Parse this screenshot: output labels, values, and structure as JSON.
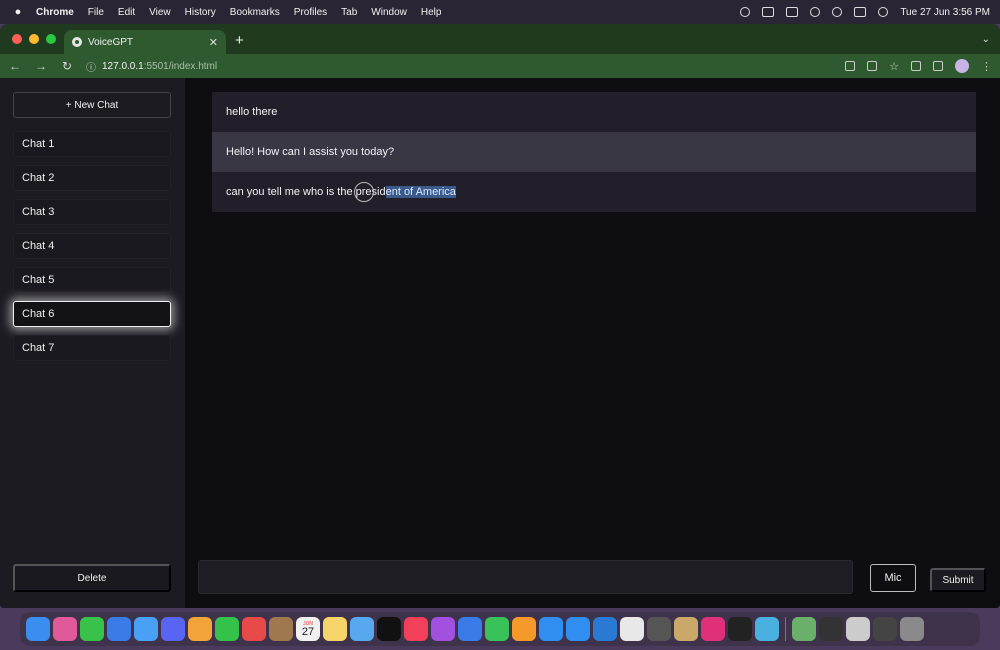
{
  "menubar": {
    "app": "Chrome",
    "items": [
      "File",
      "Edit",
      "View",
      "History",
      "Bookmarks",
      "Profiles",
      "Tab",
      "Window",
      "Help"
    ],
    "datetime": "Tue 27 Jun  3:56 PM"
  },
  "browser": {
    "tab_title": "VoiceGPT",
    "url_host": "127.0.0.1",
    "url_path": ":5501/index.html"
  },
  "sidebar": {
    "new_chat_label": "+ New Chat",
    "chats": [
      "Chat 1",
      "Chat 2",
      "Chat 3",
      "Chat 4",
      "Chat 5",
      "Chat 6",
      "Chat 7"
    ],
    "active_chat": "Chat 6",
    "delete_label": "Delete"
  },
  "conversation": {
    "messages": [
      {
        "role": "user",
        "text": "hello there"
      },
      {
        "role": "assistant",
        "text": "Hello! How can I assist you today?"
      },
      {
        "role": "user",
        "text_plain": "can you tell me who is the presid",
        "text_selected": "ent of America"
      }
    ]
  },
  "composer": {
    "input_value": "",
    "mic_label": "Mic",
    "submit_label": "Submit"
  },
  "dock": {
    "calendar_day": "27",
    "calendar_month": "JUN",
    "icon_colors": [
      "#3b8ef0",
      "#e05a9a",
      "#38c24a",
      "#3a7be8",
      "#4aa0f5",
      "#5865f2",
      "#f2a33a",
      "#35c24a",
      "#e84a4a",
      "#a07850",
      "#f0f0f0",
      "#f5d56a",
      "#58a8f0",
      "#111111",
      "#f2405a",
      "#a250e0",
      "#3a7be8",
      "#3ac25a",
      "#f59a2a",
      "#2f8ef0",
      "#2f8ef0",
      "#2a7ad4",
      "#e8e8e8",
      "#555555",
      "#c9a86a",
      "#e0307a",
      "#222222",
      "#4ab0e0",
      "#6ab06a",
      "#333333",
      "#cccccc",
      "#444444",
      "#8a8a8a"
    ]
  }
}
